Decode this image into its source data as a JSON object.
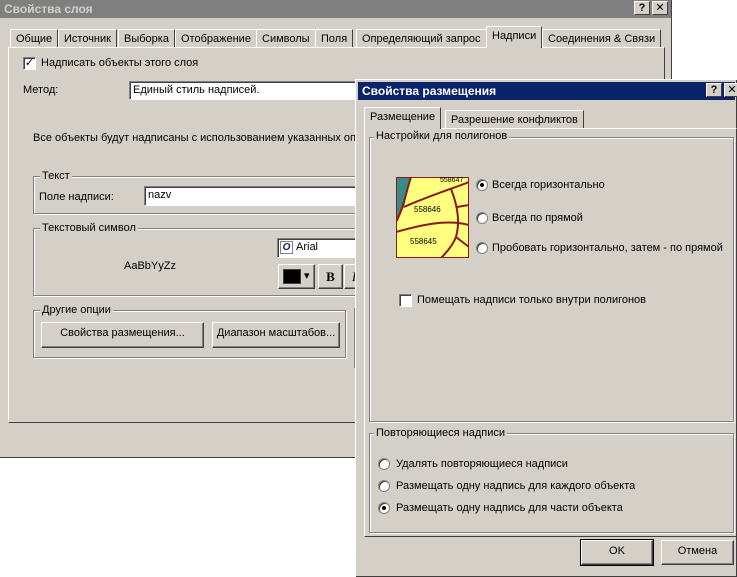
{
  "layer_dialog": {
    "title": "Свойства слоя",
    "help_btn": "?",
    "close_btn": "✕",
    "tabs": [
      {
        "label": "Общие"
      },
      {
        "label": "Источник"
      },
      {
        "label": "Выборка"
      },
      {
        "label": "Отображение"
      },
      {
        "label": "Символы"
      },
      {
        "label": "Поля"
      },
      {
        "label": "Определяющий запрос"
      },
      {
        "label": "Надписи"
      },
      {
        "label": "Соединения & Связи"
      }
    ],
    "selected_tab": "Надписи",
    "label_features_check": "✓",
    "label_features_text": "Надписать объекты этого слоя",
    "method_label": "Метод:",
    "method_value": "Единый стиль надписей.",
    "description": "Все объекты будут надписаны с использованием указанных оп",
    "text_group": {
      "title": "Текст",
      "label_field_label": "Поле надписи:",
      "label_field_value": "nazv"
    },
    "symbol_group": {
      "title": "Текстовый символ",
      "preview": "AaBbYyZz",
      "font_value": "Arial",
      "font_icon": "O",
      "color_arrow": "▾",
      "bold": "B",
      "italic": "I"
    },
    "other_group": {
      "title": "Другие опции",
      "placement_button": "Свойства размещения...",
      "scale_button": "Диапазон масштабов..."
    }
  },
  "placement_dialog": {
    "title": "Свойства размещения",
    "help_btn": "?",
    "close_btn": "✕",
    "tabs": [
      {
        "label": "Размещение"
      },
      {
        "label": "Разрешение конфликтов"
      }
    ],
    "polygon_group": {
      "title": "Настройки для полигонов",
      "map_labels": [
        "558647",
        "558646",
        "558645"
      ],
      "options": [
        {
          "label": "Всегда горизонтально",
          "selected": true
        },
        {
          "label": "Всегда по прямой",
          "selected": false
        },
        {
          "label": "Пробовать горизонтально, затем - по прямой",
          "selected": false
        }
      ],
      "inside_only_label": "Помещать надписи только внутри полигонов",
      "inside_only_checked": false
    },
    "repeat_group": {
      "title": "Повторяющиеся надписи",
      "options": [
        {
          "label": "Удалять повторяющиеся надписи",
          "selected": false
        },
        {
          "label": "Размещать одну надпись для каждого объекта",
          "selected": false
        },
        {
          "label": "Размещать одну надпись для части объекта",
          "selected": true
        }
      ]
    },
    "ok_button": "OK",
    "cancel_button": "Отмена"
  },
  "colors": {
    "inactive_title": "#808080",
    "active_title": "#0a246a",
    "dialog_face": "#d4d0c8",
    "map_polygon_fill": "#ffff80",
    "map_outline": "#8b1a1a",
    "map_water": "#3a8a8a"
  }
}
